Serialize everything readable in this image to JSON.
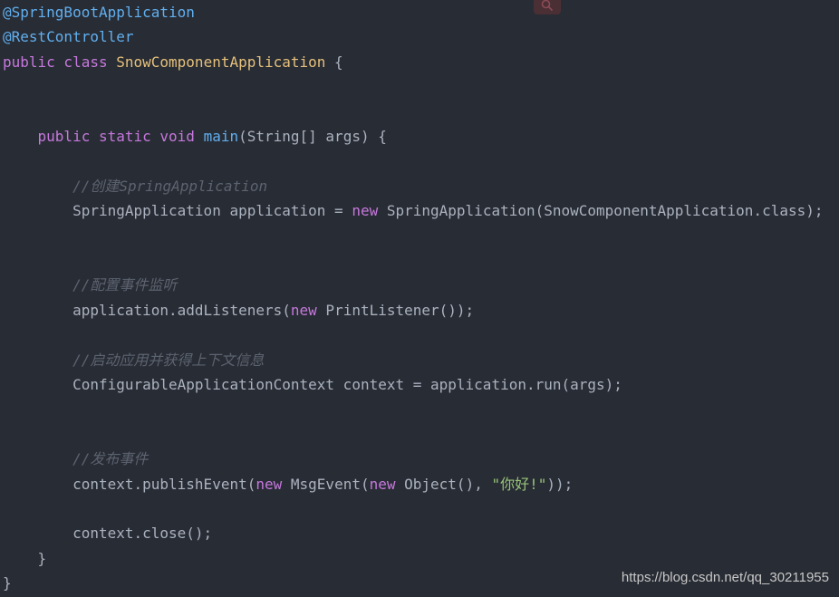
{
  "toolbar": {
    "search_icon": "magnifier-icon"
  },
  "code_lines": [
    {
      "tokens": [
        {
          "t": "@SpringBootApplication",
          "c": "ann"
        }
      ]
    },
    {
      "tokens": [
        {
          "t": "@RestController",
          "c": "ann"
        }
      ]
    },
    {
      "tokens": [
        {
          "t": "public class ",
          "c": "kw"
        },
        {
          "t": "SnowComponentApplication",
          "c": "cls"
        },
        {
          "t": " {",
          "c": "plain"
        }
      ]
    },
    {
      "tokens": []
    },
    {
      "tokens": []
    },
    {
      "tokens": [
        {
          "t": "    public static void ",
          "c": "kw"
        },
        {
          "t": "main",
          "c": "fn"
        },
        {
          "t": "(String[] args) {",
          "c": "plain"
        }
      ]
    },
    {
      "tokens": []
    },
    {
      "tokens": [
        {
          "t": "        //创建SpringApplication",
          "c": "cmt"
        }
      ]
    },
    {
      "tokens": [
        {
          "t": "        SpringApplication application = ",
          "c": "plain"
        },
        {
          "t": "new",
          "c": "kw"
        },
        {
          "t": " SpringApplication(SnowComponentApplication.class);",
          "c": "plain"
        }
      ]
    },
    {
      "tokens": []
    },
    {
      "tokens": []
    },
    {
      "tokens": [
        {
          "t": "        //配置事件监听",
          "c": "cmt"
        }
      ]
    },
    {
      "tokens": [
        {
          "t": "        application.addListeners(",
          "c": "plain"
        },
        {
          "t": "new",
          "c": "kw"
        },
        {
          "t": " PrintListener());",
          "c": "plain"
        }
      ]
    },
    {
      "tokens": []
    },
    {
      "tokens": [
        {
          "t": "        //启动应用并获得上下文信息",
          "c": "cmt"
        }
      ]
    },
    {
      "tokens": [
        {
          "t": "        ConfigurableApplicationContext context = application.run(args);",
          "c": "plain"
        }
      ]
    },
    {
      "tokens": []
    },
    {
      "tokens": []
    },
    {
      "tokens": [
        {
          "t": "        //发布事件",
          "c": "cmt"
        }
      ]
    },
    {
      "tokens": [
        {
          "t": "        context.publishEvent(",
          "c": "plain"
        },
        {
          "t": "new",
          "c": "kw"
        },
        {
          "t": " MsgEvent(",
          "c": "plain"
        },
        {
          "t": "new",
          "c": "kw"
        },
        {
          "t": " Object(), ",
          "c": "plain"
        },
        {
          "t": "\"你好!\"",
          "c": "str"
        },
        {
          "t": "));",
          "c": "plain"
        }
      ]
    },
    {
      "tokens": []
    },
    {
      "tokens": [
        {
          "t": "        context.close();",
          "c": "plain"
        }
      ]
    },
    {
      "tokens": [
        {
          "t": "    }",
          "c": "plain"
        }
      ]
    },
    {
      "tokens": [
        {
          "t": "}",
          "c": "plain"
        }
      ]
    }
  ],
  "watermark": "https://blog.csdn.net/qq_30211955"
}
